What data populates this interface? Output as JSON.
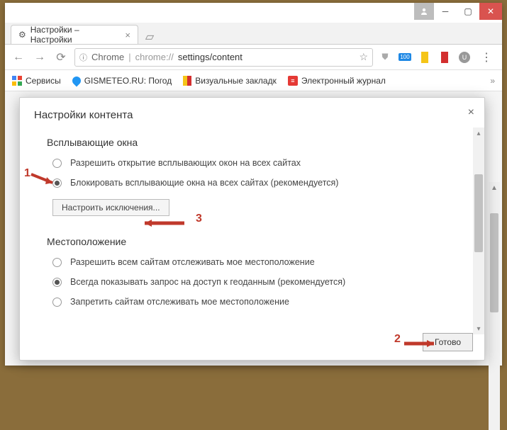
{
  "window": {
    "tab_title": "Настройки – Настройки",
    "url_scheme": "chrome://",
    "url_path": "settings/content",
    "chrome_label": "Chrome"
  },
  "bookmarks": {
    "apps": "Сервисы",
    "gismeteo": "GISMETEO.RU: Погод",
    "visual": "Визуальные закладк",
    "journal": "Электронный журнал",
    "more": "»"
  },
  "dialog": {
    "title": "Настройки контента",
    "popups": {
      "heading": "Всплывающие окна",
      "allow": "Разрешить открытие всплывающих окон на всех сайтах",
      "block": "Блокировать всплывающие окна на всех сайтах (рекомендуется)",
      "exceptions": "Настроить исключения..."
    },
    "location": {
      "heading": "Местоположение",
      "allow": "Разрешить всем сайтам отслеживать мое местоположение",
      "ask": "Всегда показывать запрос на доступ к геоданным (рекомендуется)",
      "deny": "Запретить сайтам отслеживать мое местоположение"
    },
    "done": "Готово"
  },
  "annotations": {
    "a1": "1",
    "a2": "2",
    "a3": "3"
  },
  "icons": {
    "badge": "100",
    "ub": "U"
  }
}
